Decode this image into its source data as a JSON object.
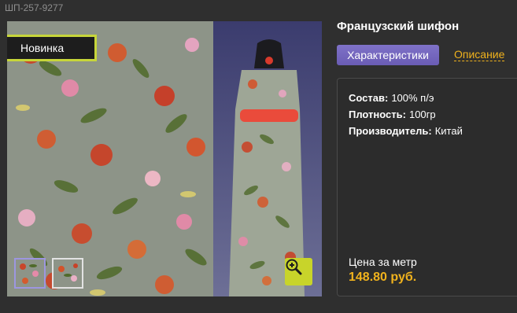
{
  "product": {
    "sku": "ШП-257-9277",
    "title": "Французский шифон",
    "badge": "Новинка"
  },
  "tabs": {
    "specs": "Характеристики",
    "description": "Описание"
  },
  "specs": [
    {
      "label": "Состав:",
      "value": "100% п/э"
    },
    {
      "label": "Плотность:",
      "value": "100гр"
    },
    {
      "label": "Производитель:",
      "value": "Китай"
    }
  ],
  "price": {
    "label": "Цена за метр",
    "value": "148.80 руб."
  },
  "icons": {
    "zoom": "magnifier-plus-icon"
  },
  "colors": {
    "background": "#2f2f2f",
    "accent_orange": "#f0b21d",
    "tab_purple": "#7566c0",
    "badge_border": "#c7d63a",
    "zoom_button": "#c8d42a"
  }
}
